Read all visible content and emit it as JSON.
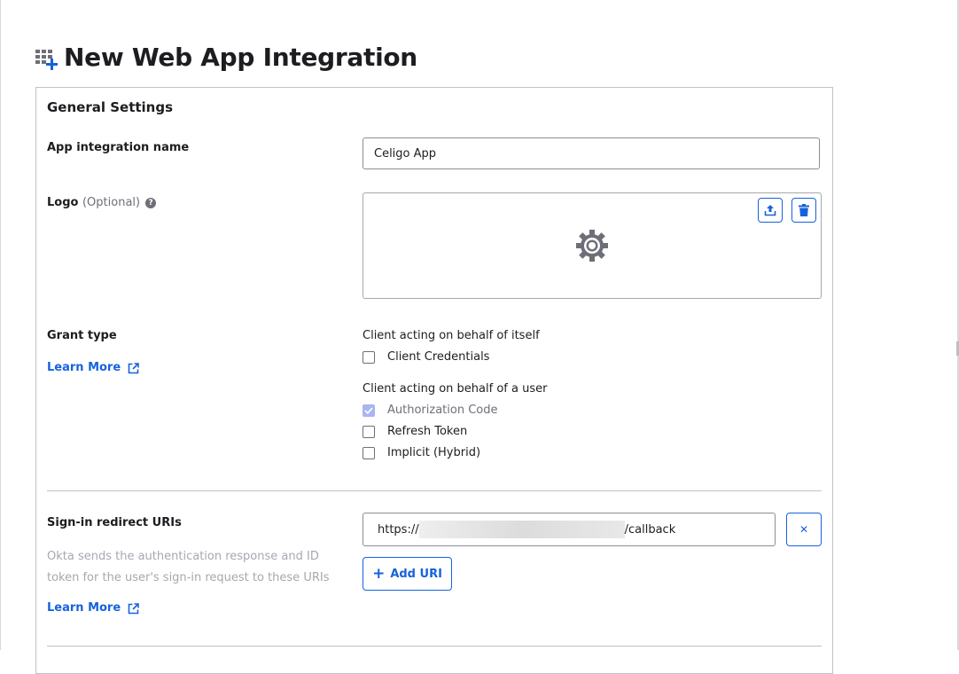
{
  "page": {
    "title": "New Web App Integration",
    "title_icon": "grid-add-icon"
  },
  "general_settings": {
    "heading": "General Settings",
    "app_name": {
      "label": "App integration name",
      "value": "Celigo App"
    },
    "logo": {
      "label": "Logo",
      "optional_text": "(Optional)",
      "help_icon": "?",
      "upload_icon": "upload-icon",
      "delete_icon": "trash-icon",
      "placeholder_icon": "gear-icon"
    },
    "grant_type": {
      "label": "Grant type",
      "learn_more": "Learn More",
      "groups": [
        {
          "heading": "Client acting on behalf of itself",
          "options": [
            {
              "label": "Client Credentials",
              "checked": false,
              "disabled": false
            }
          ]
        },
        {
          "heading": "Client acting on behalf of a user",
          "options": [
            {
              "label": "Authorization Code",
              "checked": true,
              "disabled": true
            },
            {
              "label": "Refresh Token",
              "checked": false,
              "disabled": false
            },
            {
              "label": "Implicit (Hybrid)",
              "checked": false,
              "disabled": false
            }
          ]
        }
      ]
    },
    "sign_in_redirect": {
      "label": "Sign-in redirect URIs",
      "description": "Okta sends the authentication response and ID token for the user's sign-in request to these URIs",
      "learn_more": "Learn More",
      "uri_prefix": "https://",
      "uri_suffix": "/callback",
      "remove_symbol": "✕",
      "add_label": "Add URI",
      "add_symbol": "+"
    }
  },
  "colors": {
    "accent": "#1662dd",
    "border": "#c1c1c8",
    "muted": "#6e6e78",
    "disabled_check": "#a9b6f0"
  }
}
